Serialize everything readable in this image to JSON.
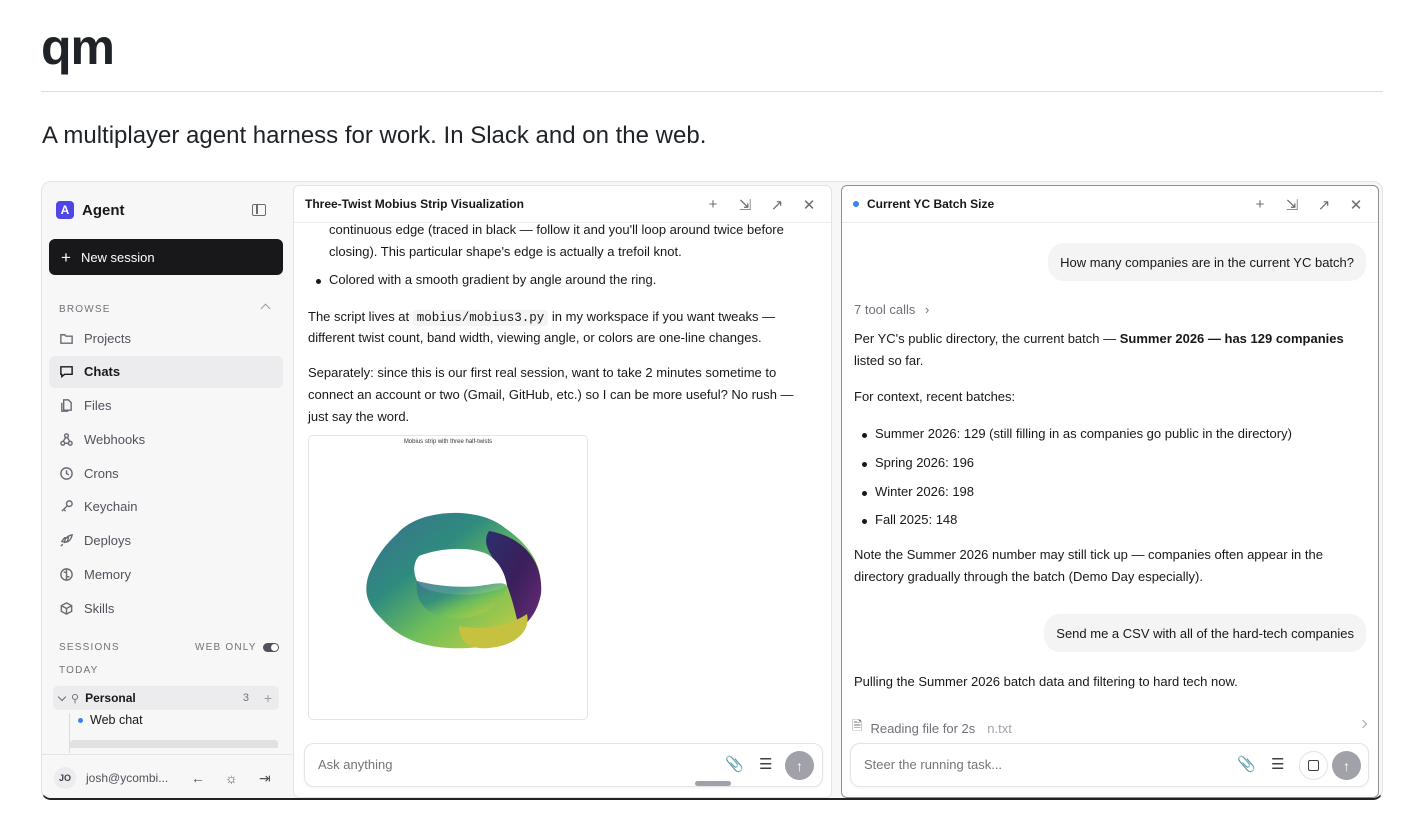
{
  "readme": {
    "title": "qm",
    "subtitle": "A multiplayer agent harness for work. In Slack and on the web."
  },
  "sidebar": {
    "brand_mark": "A",
    "brand_name": "Agent",
    "new_session": "New session",
    "browse_label": "BROWSE",
    "items": [
      {
        "label": "Projects",
        "icon": "folder-icon",
        "active": false
      },
      {
        "label": "Chats",
        "icon": "chat-icon",
        "active": true
      },
      {
        "label": "Files",
        "icon": "files-icon",
        "active": false
      },
      {
        "label": "Webhooks",
        "icon": "webhook-icon",
        "active": false
      },
      {
        "label": "Crons",
        "icon": "clock-icon",
        "active": false
      },
      {
        "label": "Keychain",
        "icon": "key-icon",
        "active": false
      },
      {
        "label": "Deploys",
        "icon": "rocket-icon",
        "active": false
      },
      {
        "label": "Memory",
        "icon": "brain-icon",
        "active": false
      },
      {
        "label": "Skills",
        "icon": "cube-icon",
        "active": false
      }
    ],
    "sessions_label": "SESSIONS",
    "web_only_label": "WEB ONLY",
    "today_label": "TODAY",
    "group": {
      "name": "Personal",
      "count": "3"
    },
    "session_item": "Web chat",
    "user": {
      "initials": "JO",
      "email": "josh@ycombi..."
    }
  },
  "panel_left": {
    "title": "Three-Twist Mobius Strip Visualization",
    "para1_line1": "continuous edge (traced in black — follow it and you'll loop around twice before",
    "para1_line2": "closing). This particular shape's edge is actually a trefoil knot.",
    "bullet": "Colored with a smooth gradient by angle around the ring.",
    "script_pre": "The script lives at ",
    "script_code": "mobius/mobius3.py",
    "script_post": " in my workspace if you want tweaks —",
    "script_line2": "different twist count, band width, viewing angle, or colors are one-line changes.",
    "sep_line1": "Separately: since this is our first real session, want to take 2 minutes sometime to",
    "sep_line2": "connect an account or two (Gmail, GitHub, etc.) so I can be more useful? No rush —",
    "sep_line3": "just say the word.",
    "plot_title": "Mobius strip with three half-twists",
    "composer_placeholder": "Ask anything"
  },
  "panel_right": {
    "title": "Current YC Batch Size",
    "user_msg1": "How many companies are in the current YC batch?",
    "tool_calls": "7 tool calls",
    "answer_pre": "Per YC's public directory, the current batch — ",
    "answer_bold": "Summer 2026 — has 129 companies",
    "answer_line2": "listed so far.",
    "context_label": "For context, recent batches:",
    "batches": [
      "Summer 2026: 129 (still filling in as companies go public in the directory)",
      "Spring 2026: 196",
      "Winter 2026: 198",
      "Fall 2025: 148"
    ],
    "note_line1": "Note the Summer 2026 number may still tick up — companies often appear in the",
    "note_line2": "directory gradually through the batch (Demo Day especially).",
    "user_msg2": "Send me a CSV with all of the hard-tech companies",
    "pulling": "Pulling the Summer 2026 batch data and filtering to hard tech now.",
    "reading": "Reading file for 2s",
    "reading_file": "n.txt",
    "composer_placeholder": "Steer the running task..."
  },
  "colors": {
    "accent": "#4f46e5",
    "status_dot": "#3b82f6"
  }
}
